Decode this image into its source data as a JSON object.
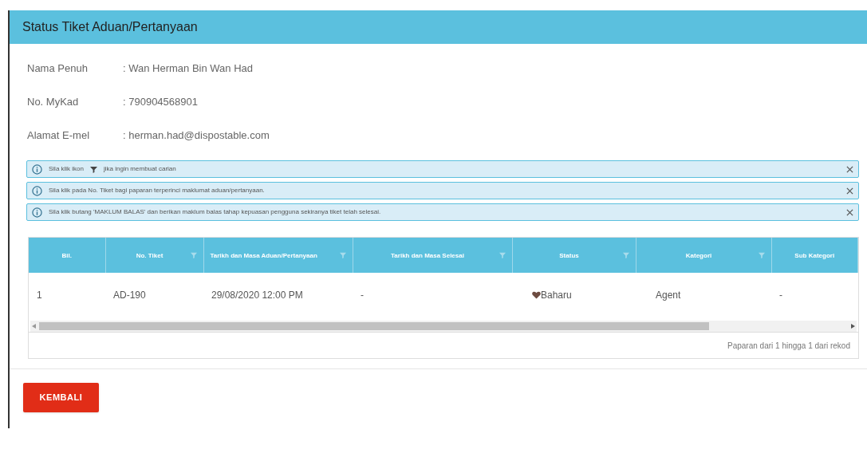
{
  "panel": {
    "title": "Status Tiket Aduan/Pertanyaan"
  },
  "details": [
    {
      "label": "Nama Penuh",
      "value": ": Wan Herman Bin Wan Had"
    },
    {
      "label": "No. MyKad",
      "value": ": 790904568901"
    },
    {
      "label": "Alamat E-mel",
      "value": ": herman.had@dispostable.com"
    }
  ],
  "alerts": [
    {
      "kind": "filter",
      "text_before": "Sila klik ikon",
      "text_after": "jika ingin membuat carian"
    },
    {
      "kind": "plain",
      "text": "Sila klik pada No. Tiket bagi paparan terperinci maklumat aduan/pertanyaan."
    },
    {
      "kind": "plain",
      "text": "Sila klik butang 'MAKLUM BALAS' dan berikan maklum balas tahap kepuasan pengguna sekiranya tiket telah selesai."
    }
  ],
  "table": {
    "columns": [
      {
        "label": "Bil.",
        "sortable": false
      },
      {
        "label": "No. Tiket",
        "sortable": true
      },
      {
        "label": "Tarikh dan Masa Aduan/Pertanyaan",
        "sortable": true
      },
      {
        "label": "Tarikh dan Masa Selesai",
        "sortable": true
      },
      {
        "label": "Status",
        "sortable": true
      },
      {
        "label": "Kategori",
        "sortable": true
      },
      {
        "label": "Sub Kategori",
        "sortable": false
      }
    ],
    "rows": [
      [
        "1",
        "AD-190",
        "29/08/2020 12:00 PM",
        "-",
        "Baharu",
        "Agent",
        "-"
      ]
    ],
    "footer": "Paparan dari 1 hingga 1 dari rekod"
  },
  "back_button": "KEMBALI"
}
